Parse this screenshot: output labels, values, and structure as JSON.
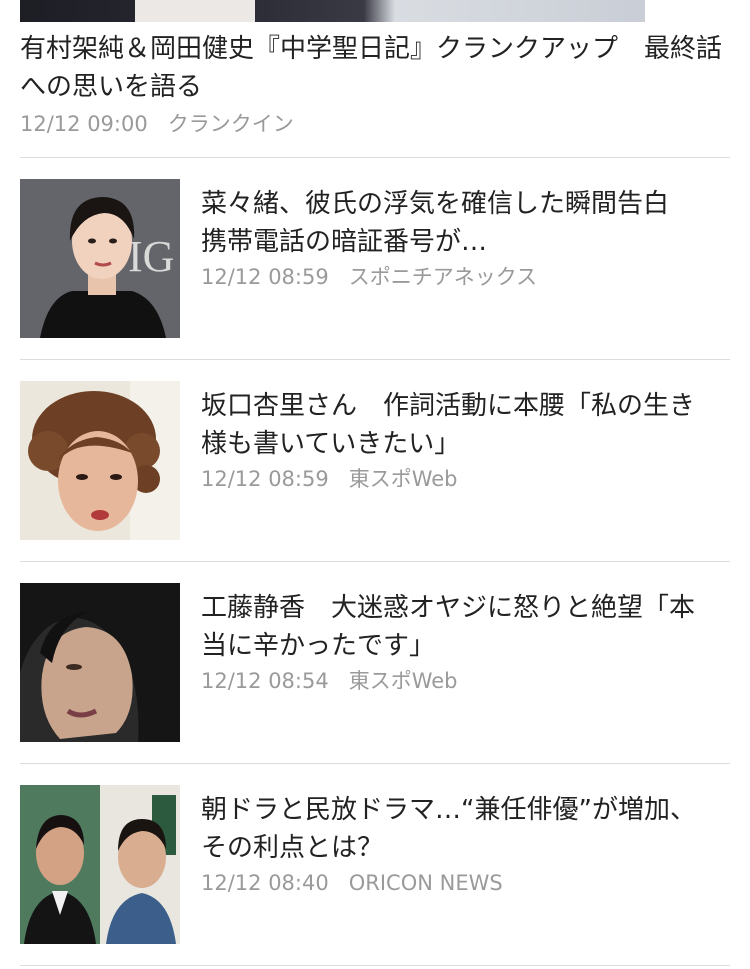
{
  "top_article": {
    "title": "有村架純＆岡田健史『中学聖日記』クランクアップ　最終話への思いを語る",
    "time": "12/12 09:00",
    "source": "クランクイン"
  },
  "articles": [
    {
      "title": "菜々緒、彼氏の浮気を確信した瞬間告白　携帯電話の暗証番号が…",
      "time": "12/12 08:59",
      "source": "スポニチアネックス",
      "thumb_text": "IG"
    },
    {
      "title": "坂口杏里さん　作詞活動に本腰「私の生き様も書いていきたい」",
      "time": "12/12 08:59",
      "source": "東スポWeb"
    },
    {
      "title": "工藤静香　大迷惑オヤジに怒りと絶望「本当に辛かったです」",
      "time": "12/12 08:54",
      "source": "東スポWeb"
    },
    {
      "title": "朝ドラと民放ドラマ…“兼任俳優”が増加、その利点とは？",
      "time": "12/12 08:40",
      "source": "ORICON NEWS"
    }
  ]
}
